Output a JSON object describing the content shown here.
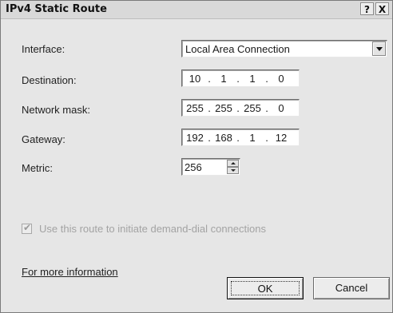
{
  "window": {
    "title": "IPv4 Static Route",
    "help_label": "?",
    "close_label": "X"
  },
  "form": {
    "interface_label": "Interface:",
    "interface_value": "Local Area Connection",
    "destination_label": "Destination:",
    "destination_octets": [
      "10",
      "1",
      "1",
      "0"
    ],
    "mask_label": "Network mask:",
    "mask_octets": [
      "255",
      "255",
      "255",
      "0"
    ],
    "gateway_label": "Gateway:",
    "gateway_octets": [
      "192",
      "168",
      "1",
      "12"
    ],
    "metric_label": "Metric:",
    "metric_value": "256",
    "demand_dial_label": "Use this route to initiate demand-dial connections",
    "demand_dial_checked": true,
    "demand_dial_enabled": false
  },
  "footer": {
    "info_link": "For more information",
    "ok_label": "OK",
    "cancel_label": "Cancel"
  },
  "icons": {
    "dropdown": "chevron-down-icon",
    "spin_up": "spin-up-icon",
    "spin_down": "spin-down-icon",
    "check": "checkmark-icon"
  }
}
